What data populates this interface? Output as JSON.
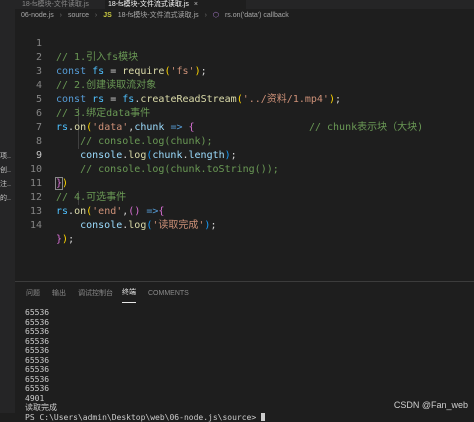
{
  "tabs": [
    {
      "label": "18-fs模块-文件读取.js",
      "active": false
    },
    {
      "label": "18-fs模块-文件流式读取.js",
      "active": true,
      "close": "×"
    }
  ],
  "breadcrumb": {
    "items": [
      "06-node.js",
      "source",
      "18-fs模块-文件流式读取.js",
      "rs.on('data') callback"
    ],
    "separator": "›"
  },
  "left_labels": [
    "项..",
    "创..",
    "注..",
    "的.."
  ],
  "code_lines": [
    {
      "n": "1",
      "text": "// 1.引入fs模块"
    },
    {
      "n": "2",
      "text": "const fs = require('fs');"
    },
    {
      "n": "3",
      "text": "// 2.创建读取流对象"
    },
    {
      "n": "4",
      "text": "const rs = fs.createReadStream('../资料/1.mp4');"
    },
    {
      "n": "5",
      "text": "// 3.绑定data事件"
    },
    {
      "n": "6",
      "text": "rs.on('data',chunk => {                   // chunk表示块（大块)"
    },
    {
      "n": "7",
      "text": "    // console.log(chunk);"
    },
    {
      "n": "8",
      "text": "    console.log(chunk.length);"
    },
    {
      "n": "9",
      "text": "    // console.log(chunk.toString());"
    },
    {
      "n": "10",
      "text": "})"
    },
    {
      "n": "11",
      "text": "// 4.可选事件"
    },
    {
      "n": "12",
      "text": "rs.on('end',() =>{"
    },
    {
      "n": "13",
      "text": "    console.log('读取完成');"
    },
    {
      "n": "14",
      "text": "});"
    }
  ],
  "panel_tabs": [
    "问题",
    "输出",
    "调试控制台",
    "终端",
    "COMMENTS"
  ],
  "active_panel_tab": "终端",
  "terminal_lines": [
    "65536",
    "65536",
    "65536",
    "65536",
    "65536",
    "65536",
    "65536",
    "65536",
    "65536",
    "4901"
  ],
  "terminal_done": "读取完成",
  "terminal_prompt": "PS C:\\Users\\admin\\Desktop\\web\\06-node.js\\source> ",
  "watermark": "CSDN @Fan_web"
}
